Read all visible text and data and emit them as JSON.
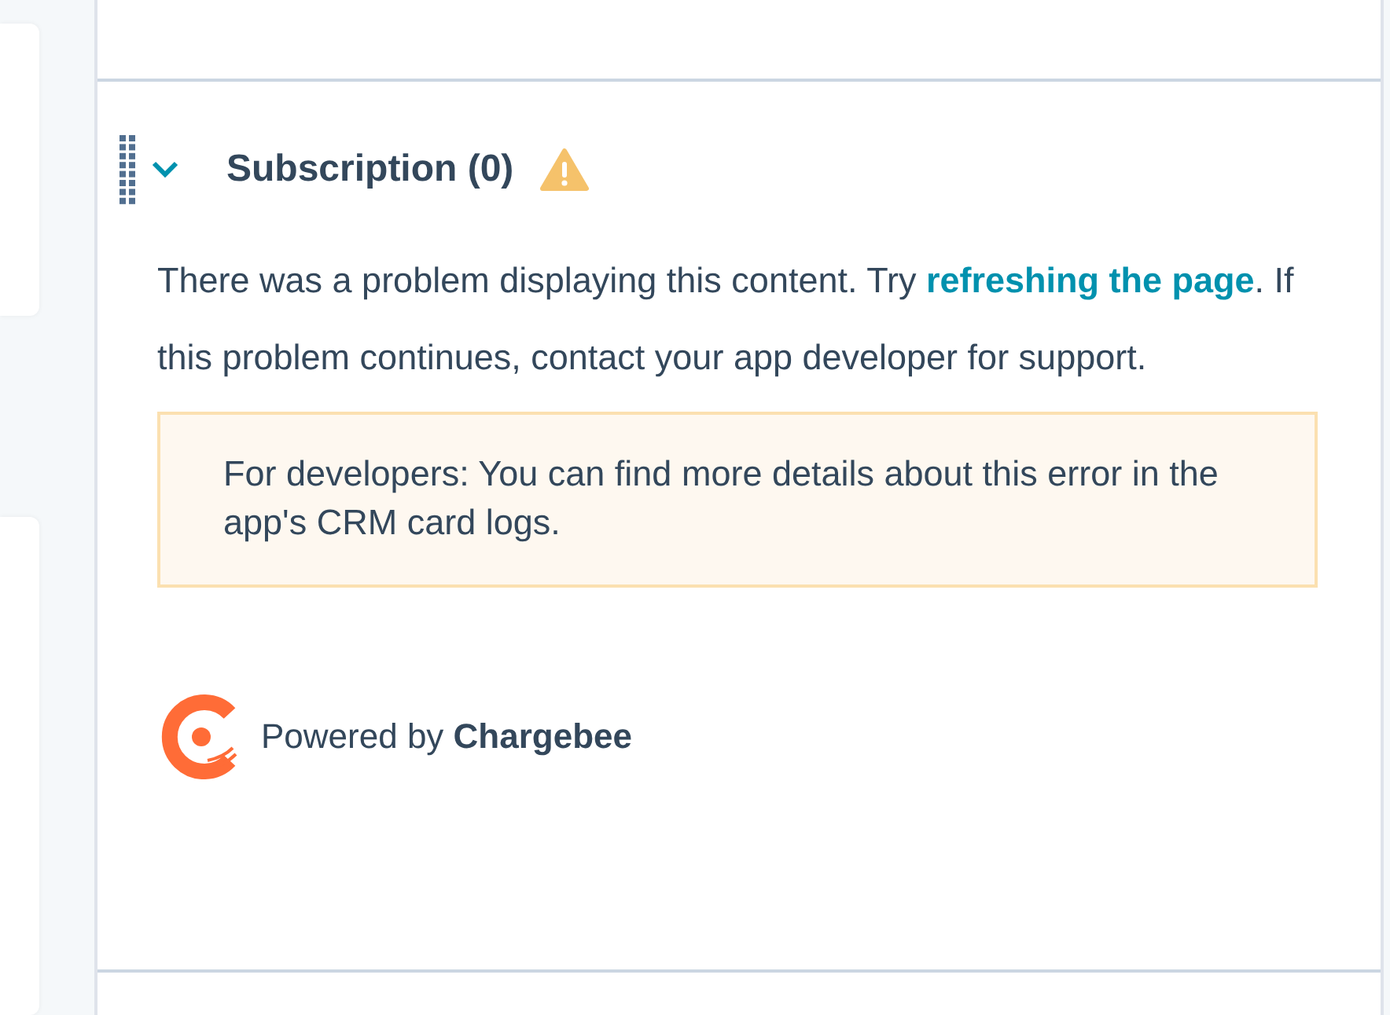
{
  "card": {
    "title": "Subscription (0)",
    "expanded": true,
    "message": {
      "before": "There was a problem displaying this content. Try ",
      "link": "refreshing the page",
      "after": ". If this problem continues, contact your app developer for support."
    },
    "developer_note": "For developers: You can find more details about this error in the app's CRM card logs.",
    "footer": {
      "prefix": "Powered by",
      "brand": "Chargebee"
    }
  }
}
